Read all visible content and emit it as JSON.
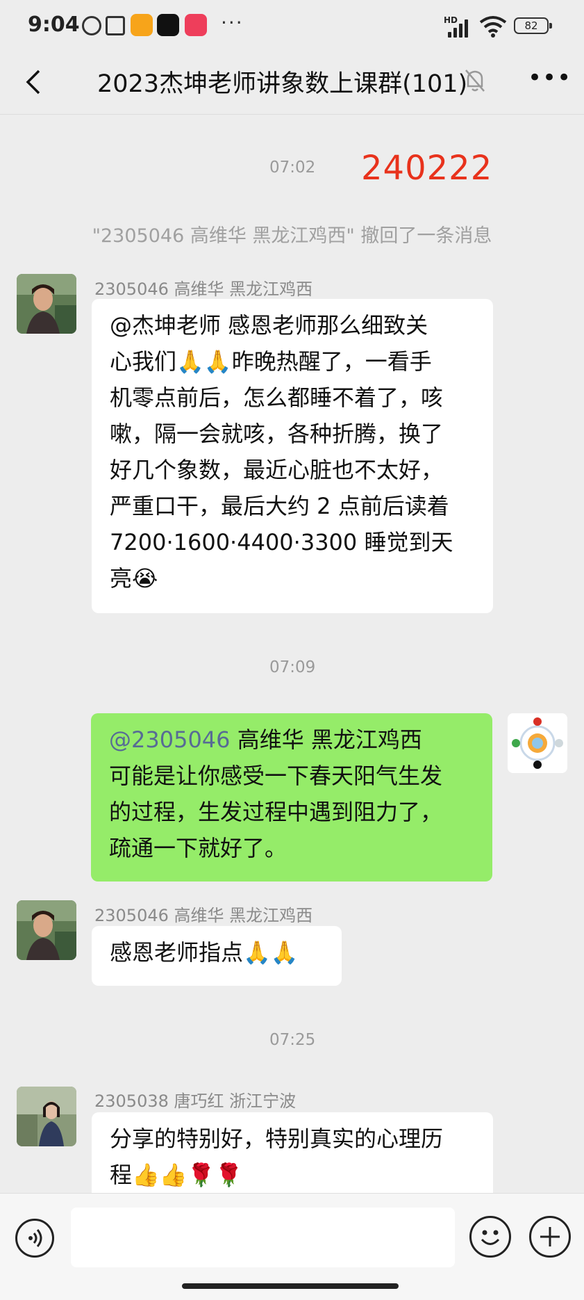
{
  "status_bar": {
    "time": "9:04",
    "network": "HD",
    "battery": "82"
  },
  "header": {
    "title": "2023杰坤老师讲象数上课群(101)"
  },
  "messages": {
    "date_mark": "240222",
    "ts1": "07:02",
    "recall_notice": "\"2305046   高维华  黑龙江鸡西\" 撤回了一条消息",
    "m1": {
      "sender": "2305046   高维华  黑龙江鸡西",
      "lines": [
        "@杰坤老师  感恩老师那么细致关",
        "心我们🙏🙏昨晚热醒了，一看手",
        "机零点前后，怎么都睡不着了，咳",
        "嗽，隔一会就咳，各种折腾，换了",
        "好几个象数，最近心脏也不太好，",
        "严重口干，最后大约 2 点前后读着",
        "7200·1600·4400·3300 睡觉到天",
        "亮😭"
      ]
    },
    "ts2": "07:09",
    "m2": {
      "mention": "@2305046",
      "first_line_rest": "   高维华  黑龙江鸡西",
      "lines": [
        "可能是让你感受一下春天阳气生发",
        "的过程，生发过程中遇到阻力了，",
        "疏通一下就好了。"
      ]
    },
    "m3": {
      "sender": "2305046   高维华  黑龙江鸡西",
      "text": "感恩老师指点🙏🙏"
    },
    "ts3": "07:25",
    "m4": {
      "sender": "2305038  唐巧红    浙江宁波",
      "lines": [
        "分享的特别好，特别真实的心理历",
        "程👍👍🌹🌹"
      ]
    }
  },
  "colors": {
    "date_mark": "#e8321c",
    "outgoing_bubble": "#95ec69",
    "mention": "#576b95"
  }
}
